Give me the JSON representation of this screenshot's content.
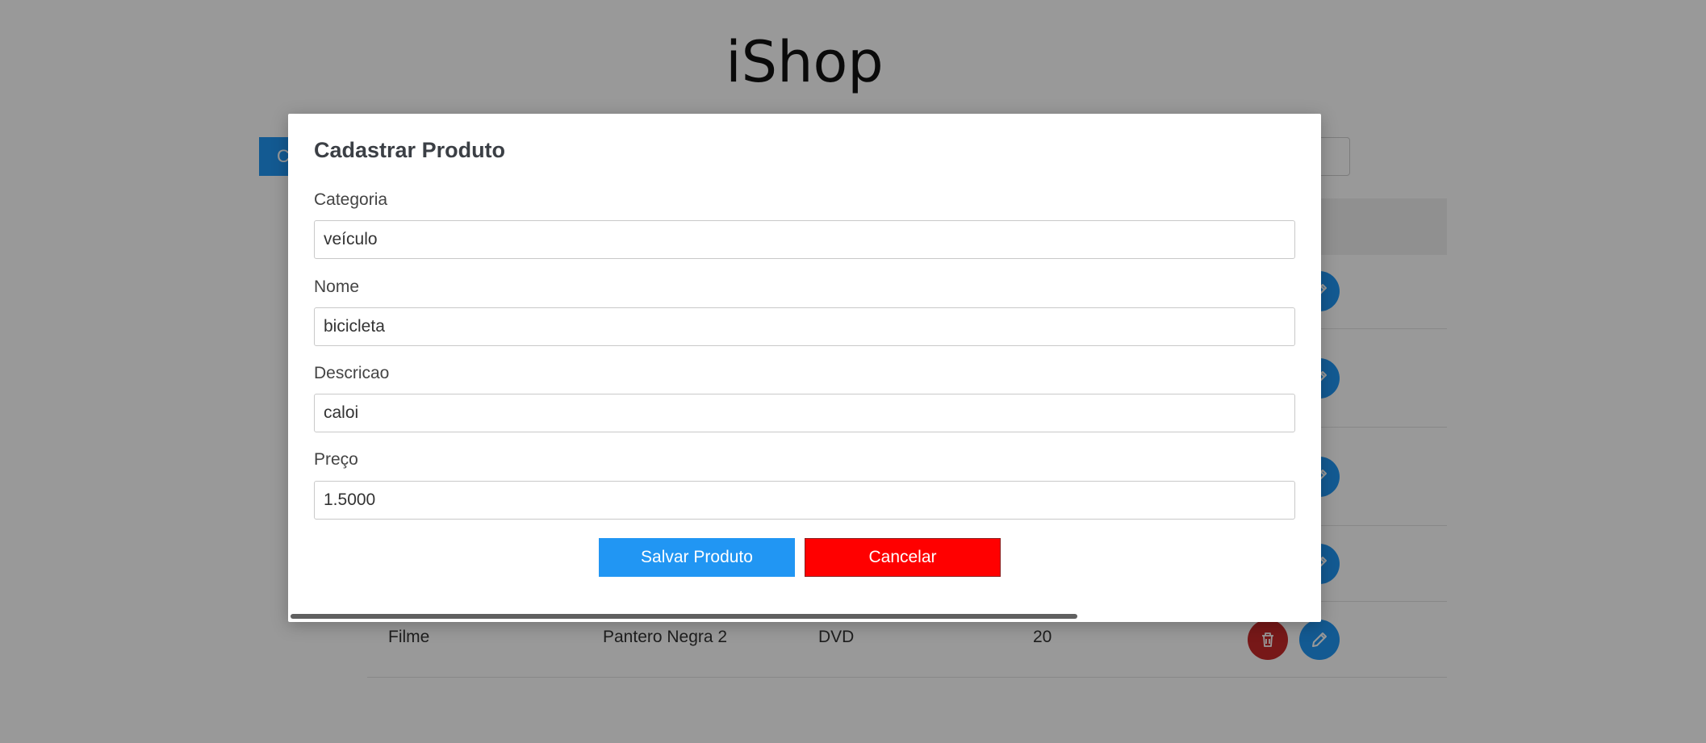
{
  "app": {
    "title": "iShop"
  },
  "toolbar": {
    "new_label": "C"
  },
  "table": {
    "rows": [
      {
        "categoria": "",
        "nome": "",
        "descricao": "",
        "preco": ""
      },
      {
        "categoria": "",
        "nome": "",
        "descricao": "",
        "preco": ""
      },
      {
        "categoria": "",
        "nome": "",
        "descricao": "",
        "preco": ""
      },
      {
        "categoria": "",
        "nome": "",
        "descricao": "",
        "preco": ""
      },
      {
        "categoria": "Filme",
        "nome": "Pantero Negra 2",
        "descricao": "DVD",
        "preco": "20"
      }
    ]
  },
  "modal": {
    "title": "Cadastrar Produto",
    "fields": {
      "categoria": {
        "label": "Categoria",
        "value": "veículo"
      },
      "nome": {
        "label": "Nome",
        "value": "bicicleta"
      },
      "descricao": {
        "label": "Descricao",
        "value": "caloi"
      },
      "preco": {
        "label": "Preço",
        "value": "1.5000"
      }
    },
    "save_label": "Salvar Produto",
    "cancel_label": "Cancelar"
  },
  "icons": {
    "delete": "trash-icon",
    "edit": "pencil-icon"
  },
  "colors": {
    "primary": "#2196f3",
    "danger": "#ff0000",
    "delete_button": "#c62828"
  }
}
